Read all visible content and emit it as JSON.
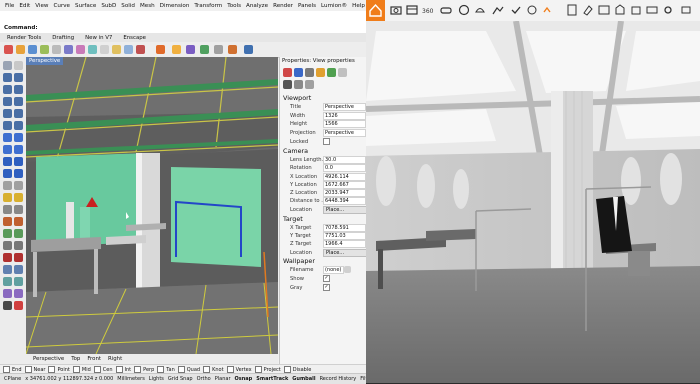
{
  "menu": [
    "File",
    "Edit",
    "View",
    "Curve",
    "Surface",
    "SubD",
    "Solid",
    "Mesh",
    "Dimension",
    "Transform",
    "Tools",
    "Analyze",
    "Render",
    "Panels",
    "Lumion®",
    "Help"
  ],
  "command": {
    "label": "Command:"
  },
  "toolbar_tabs": [
    "Render Tools",
    "Drafting",
    "New in V7",
    "Enscape"
  ],
  "viewport": {
    "title": "Perspective"
  },
  "properties": {
    "title": "Properties: View properties",
    "viewport_section": "Viewport",
    "title_label": "Title",
    "title_value": "Perspective",
    "width_label": "Width",
    "width_value": "1326",
    "height_label": "Height",
    "height_value": "1566",
    "projection_label": "Projection",
    "projection_value": "Perspective",
    "locked_label": "Locked",
    "camera_section": "Camera",
    "lens_label": "Lens Length...",
    "lens_value": "30.0",
    "rotation_label": "Rotation",
    "rotation_value": "0.0",
    "xloc_label": "X Location",
    "xloc_value": "4926.114",
    "yloc_label": "Y Location",
    "yloc_value": "1672.667",
    "zloc_label": "Z Location",
    "zloc_value": "2033.947",
    "dist_label": "Distance to ...",
    "dist_value": "6448.394",
    "location_label": "Location",
    "place_label": "Place...",
    "target_section": "Target",
    "xtar_label": "X Target",
    "xtar_value": "7078.591",
    "ytar_label": "Y Target",
    "ytar_value": "7751.03",
    "ztar_label": "Z Target",
    "ztar_value": "1966.4",
    "tlocation_label": "Location",
    "tplace_label": "Place...",
    "wallpaper_section": "Wallpaper",
    "filename_label": "Filename",
    "filename_value": "(none)",
    "show_label": "Show",
    "gray_label": "Gray"
  },
  "viewport_tabs": [
    "Perspective",
    "Top",
    "Front",
    "Right"
  ],
  "osnaps": [
    "End",
    "Near",
    "Point",
    "Mid",
    "Cen",
    "Int",
    "Perp",
    "Tan",
    "Quad",
    "Knot",
    "Vertex",
    "Project",
    "Disable"
  ],
  "status": {
    "plane": "CPlane",
    "coords": "x 34761.002 y 112897.324 z 0.000",
    "units": "Millimeters",
    "layer": "Lights",
    "items": [
      "Grid Snap",
      "Ortho",
      "Planar"
    ],
    "bold_items": [
      "Osnap",
      "SmartTrack",
      "Gumball"
    ],
    "tail": [
      "Record History",
      "Filter"
    ]
  },
  "colors": {
    "lumion_accent": "#f07d1a",
    "viewport_title": "#5a7fb8"
  }
}
